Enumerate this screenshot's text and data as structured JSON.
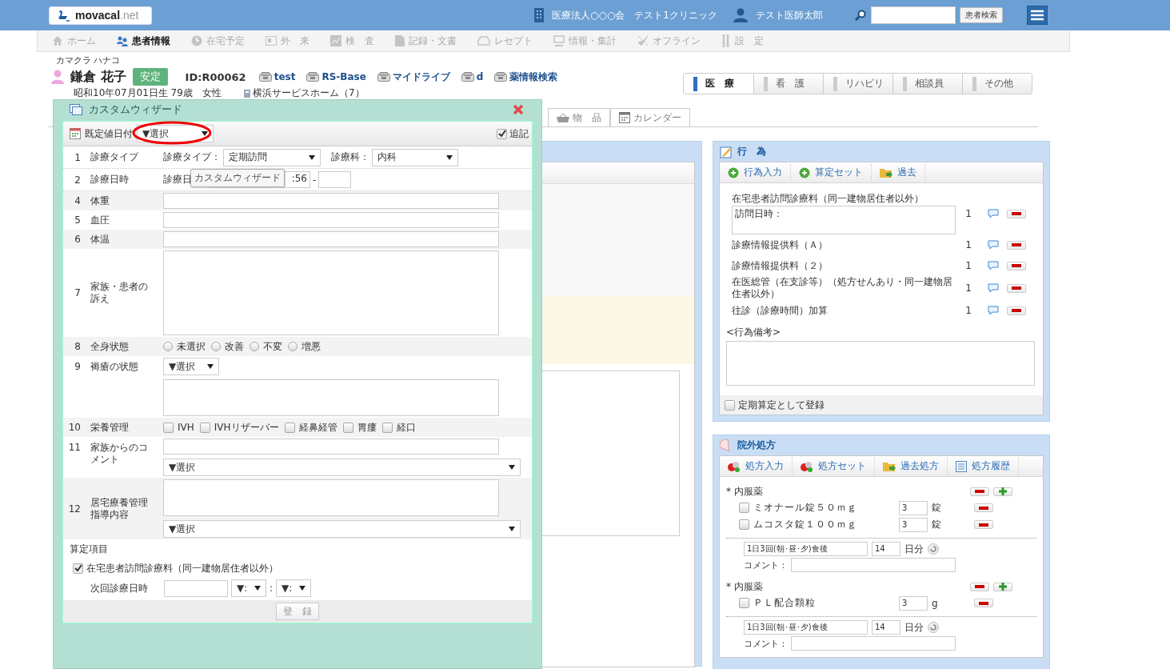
{
  "header": {
    "logo": "movacal",
    "logo_suffix": ".net",
    "org": "医療法人○○○会",
    "clinic": "テスト1クリニック",
    "user": "テスト医師太郎",
    "search_button": "患者検索"
  },
  "nav": [
    {
      "label": "ホーム",
      "kind": "home",
      "selected": false
    },
    {
      "label": "患者情報",
      "kind": "people",
      "selected": true
    },
    {
      "label": "在宅予定",
      "kind": "clock",
      "selected": false
    },
    {
      "label": "外　来",
      "kind": "card",
      "selected": false
    },
    {
      "label": "検　査",
      "kind": "chart",
      "selected": false
    },
    {
      "label": "記録・文書",
      "kind": "document",
      "selected": false
    },
    {
      "label": "レセプト",
      "kind": "tray",
      "selected": false
    },
    {
      "label": "情報・集計",
      "kind": "monitor",
      "selected": false
    },
    {
      "label": "オフライン",
      "kind": "plane",
      "selected": false
    },
    {
      "label": "設　定",
      "kind": "tools",
      "selected": false
    }
  ],
  "patient": {
    "kana": "カマクラ ハナコ",
    "name": "鎌倉 花子",
    "status": "安定",
    "id": "ID:R00062",
    "links": [
      "test",
      "RS-Base",
      "マイドライブ",
      "d",
      "薬情報検索"
    ],
    "birth": "昭和10年07月01日生 79歳",
    "sex": "女性",
    "facility": "横浜サービスホーム（7）"
  },
  "dept_tabs": [
    {
      "label": "医　療",
      "selected": true
    },
    {
      "label": "看　護",
      "selected": false
    },
    {
      "label": "リハビリ",
      "selected": false
    },
    {
      "label": "相談員",
      "selected": false
    },
    {
      "label": "その他",
      "selected": false
    }
  ],
  "sub_tabs": [
    {
      "label": "物　品",
      "kind": "basket"
    },
    {
      "label": "カレンダー",
      "kind": "calendar"
    }
  ],
  "wizard": {
    "title": "カスタムウィザード",
    "default_date": {
      "label": "既定値日付",
      "value": "▼選択",
      "highlighted": true
    },
    "append": {
      "label": "追記",
      "checked": true
    },
    "tooltip": "カスタムウィザード",
    "rows": [
      {
        "num": "1",
        "label": "診療タイプ",
        "kind": "selects",
        "selects": [
          {
            "label": "診療タイプ：",
            "value": "定期訪問"
          },
          {
            "label": "診療科：",
            "value": "内科"
          }
        ]
      },
      {
        "num": "2",
        "label": "診療日時",
        "kind": "datetime",
        "field_label": "診療日",
        "time": ":56",
        "separator": "-"
      },
      {
        "num": "4",
        "label": "体重",
        "kind": "text"
      },
      {
        "num": "5",
        "label": "血圧",
        "kind": "text"
      },
      {
        "num": "6",
        "label": "体温",
        "kind": "text"
      },
      {
        "num": "7",
        "label": "家族・患者の訴え",
        "kind": "textarea"
      },
      {
        "num": "8",
        "label": "全身状態",
        "kind": "radio",
        "options": [
          {
            "label": "未選択",
            "selected": false
          },
          {
            "label": "改善",
            "selected": false
          },
          {
            "label": "不変",
            "selected": false
          },
          {
            "label": "増悪",
            "selected": false
          }
        ]
      },
      {
        "num": "9",
        "label": "褥瘡の状態",
        "kind": "select_textarea",
        "value": "▼選択"
      },
      {
        "num": "10",
        "label": "栄養管理",
        "kind": "checks",
        "options": [
          {
            "label": "IVH",
            "checked": false
          },
          {
            "label": "IVHリザーバー",
            "checked": false
          },
          {
            "label": "経鼻経管",
            "checked": false
          },
          {
            "label": "胃瘻",
            "checked": false
          },
          {
            "label": "経口",
            "checked": false
          }
        ]
      },
      {
        "num": "11",
        "label": "家族からのコメント",
        "kind": "text_select",
        "value": "▼選択"
      },
      {
        "num": "12",
        "label": "居宅療養管理指導内容",
        "kind": "textarea_select",
        "value": "▼選択"
      }
    ],
    "billing_label": "算定項目",
    "billing": [
      {
        "label": "在宅患者訪問診療料（同一建物居住者以外）",
        "checked": true
      }
    ],
    "next_visit": {
      "label": "次回診療日時",
      "hour": "▼:",
      "separator": ":",
      "minute": "▼:"
    },
    "submit": "登　録"
  },
  "action_panel": {
    "title": "行　為",
    "toolbar": [
      {
        "label": "行為入力",
        "kind": "add"
      },
      {
        "label": "算定セット",
        "kind": "add"
      },
      {
        "label": "過去",
        "kind": "folder"
      }
    ],
    "items": [
      {
        "name": "在宅患者訪問診療料（同一建物居住者以外）",
        "note": "訪問日時：",
        "count": "1"
      },
      {
        "name": "診療情報提供料（Ａ）",
        "count": "1"
      },
      {
        "name": "診療情報提供料（２）",
        "count": "1"
      },
      {
        "name": "在医総管（在支診等）（処方せんあり・同一建物居住者以外）",
        "count": "1"
      },
      {
        "name": "往診（診療時間）加算",
        "count": "1"
      }
    ],
    "remarks_label": "<行為備考>",
    "periodic": {
      "label": "定期算定として登録",
      "checked": false
    }
  },
  "rx_panel": {
    "title": "院外処方",
    "toolbar": [
      {
        "label": "処方入力",
        "kind": "pills"
      },
      {
        "label": "処方セット",
        "kind": "pills"
      },
      {
        "label": "過去処方",
        "kind": "folder"
      },
      {
        "label": "処方履歴",
        "kind": "list"
      }
    ],
    "groups": [
      {
        "category": "* 内服薬",
        "drugs": [
          {
            "name": "ミオナール錠５０ｍｇ",
            "checked": false,
            "qty": "3",
            "unit": "錠"
          },
          {
            "name": "ムコスタ錠１００ｍｇ",
            "checked": false,
            "qty": "3",
            "unit": "錠"
          }
        ],
        "usage": "1日3回(朝･昼･夕)食後",
        "days": "14",
        "days_unit": "日分",
        "comment_label": "コメント："
      },
      {
        "category": "* 内服薬",
        "drugs": [
          {
            "name": "ＰＬ配合顆粒",
            "checked": false,
            "qty": "3",
            "unit": "g"
          }
        ],
        "usage": "1日3回(朝･昼･夕)食後",
        "days": "14",
        "days_unit": "日分",
        "comment_label": "コメント："
      }
    ]
  }
}
